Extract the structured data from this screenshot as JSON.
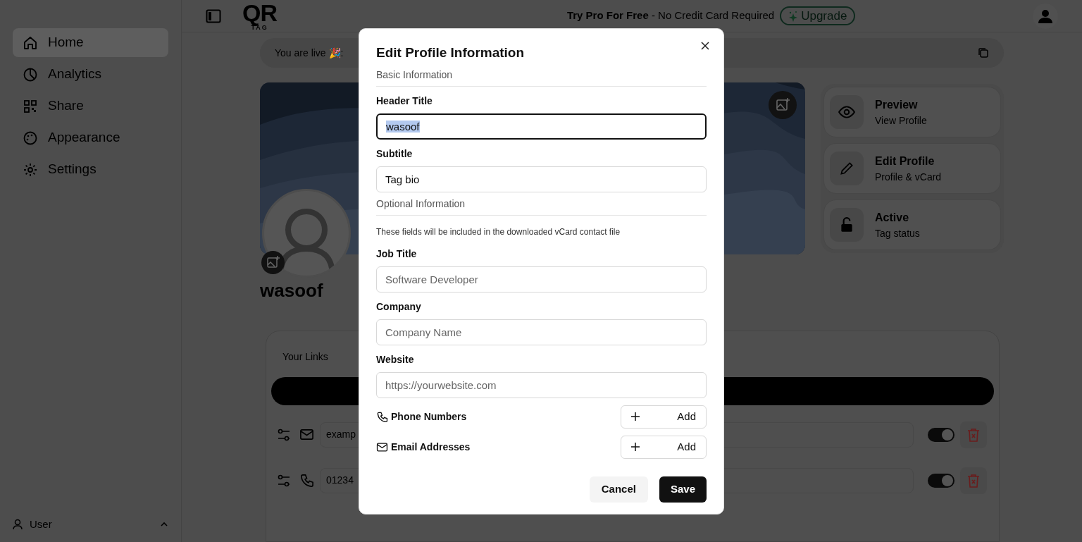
{
  "sidebar": {
    "items": [
      {
        "label": "Home",
        "selected": true
      },
      {
        "label": "Analytics",
        "selected": false
      },
      {
        "label": "Share",
        "selected": false
      },
      {
        "label": "Appearance",
        "selected": false
      },
      {
        "label": "Settings",
        "selected": false
      }
    ],
    "user": "User"
  },
  "topbar": {
    "logo": "QR",
    "logo_sub": "TAG",
    "promo": "**Try Pro For Free** - No Credit Card Required",
    "upgrade": "Upgrade"
  },
  "live_bar": {
    "label": "You are live 🎉:"
  },
  "profile": {
    "name": "wasoof"
  },
  "actions": [
    {
      "title": "Preview",
      "subtitle": "View Profile"
    },
    {
      "title": "Edit Profile",
      "subtitle": "Profile & vCard"
    },
    {
      "title": "Active",
      "subtitle": "Tag status"
    }
  ],
  "links": {
    "title": "Your Links",
    "rows": [
      {
        "value": "examp",
        "on": true
      },
      {
        "value": "01234",
        "on": true
      }
    ]
  },
  "modal": {
    "title": "Edit Profile Information",
    "sections": [
      {
        "kind": "heading",
        "text": "Basic Information"
      },
      {
        "kind": "field",
        "label": "Header Title",
        "value": "wasoof",
        "focused": true
      },
      {
        "kind": "field",
        "label": "Subtitle",
        "value": "Tag bio",
        "focused": false
      },
      {
        "kind": "heading",
        "text": "Optional Information"
      },
      {
        "kind": "note",
        "text": "These fields will be included in the downloaded vCard contact file"
      },
      {
        "kind": "field",
        "label": "Job Title",
        "placeholder": "Software Developer",
        "focused": false
      },
      {
        "kind": "field",
        "label": "Company",
        "placeholder": "Company Name",
        "focused": false
      },
      {
        "kind": "field",
        "label": "Website",
        "placeholder": "https://yourwebsite.com",
        "focused": false
      },
      {
        "kind": "list",
        "label": "Phone Numbers",
        "button": "Add"
      },
      {
        "kind": "list",
        "label": "Email Addresses",
        "button": "Add"
      }
    ],
    "cancel": "Cancel",
    "save": "Save"
  }
}
